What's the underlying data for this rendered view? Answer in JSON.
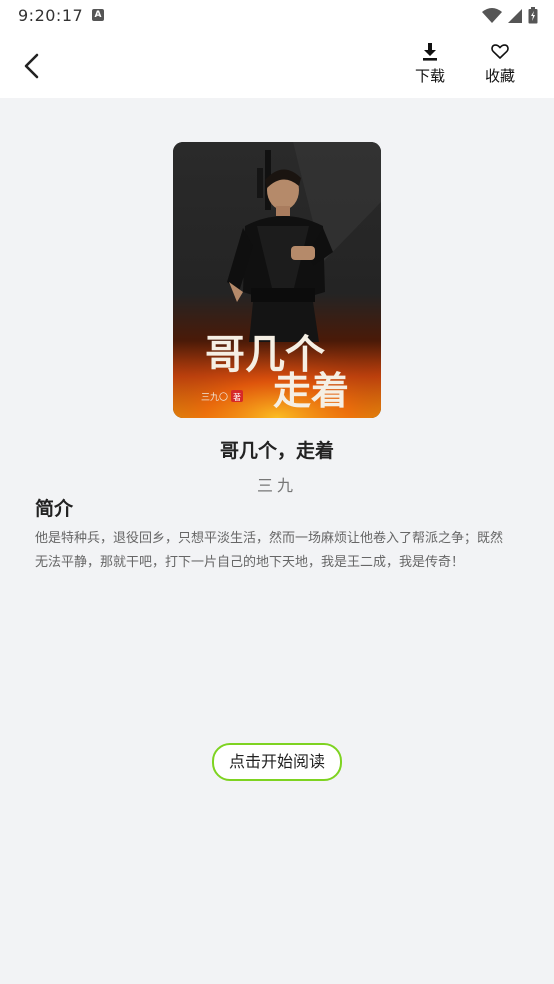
{
  "status_bar": {
    "time": "9:20:17",
    "notification_icon_letter": "A",
    "icons": [
      "wifi-icon",
      "signal-icon",
      "battery-icon"
    ]
  },
  "header": {
    "back_icon": "chevron-left-icon",
    "download_label": "下载",
    "favorite_label": "收藏"
  },
  "book": {
    "cover_title_line1": "哥几个",
    "cover_title_line2": "走着",
    "cover_author": "三九〇",
    "cover_author_badge": "著",
    "title": "哥几个，走着",
    "author": "三九",
    "intro_heading": "简介",
    "intro": "他是特种兵，退役回乡，只想平淡生活，然而一场麻烦让他卷入了帮派之争；既然无法平静，那就干吧，打下一片自己的地下天地，我是王二成，我是传奇！"
  },
  "actions": {
    "start_reading": "点击开始阅读"
  },
  "colors": {
    "accent_border": "#7ed321",
    "background": "#f2f3f5",
    "header_bg": "#ffffff"
  }
}
